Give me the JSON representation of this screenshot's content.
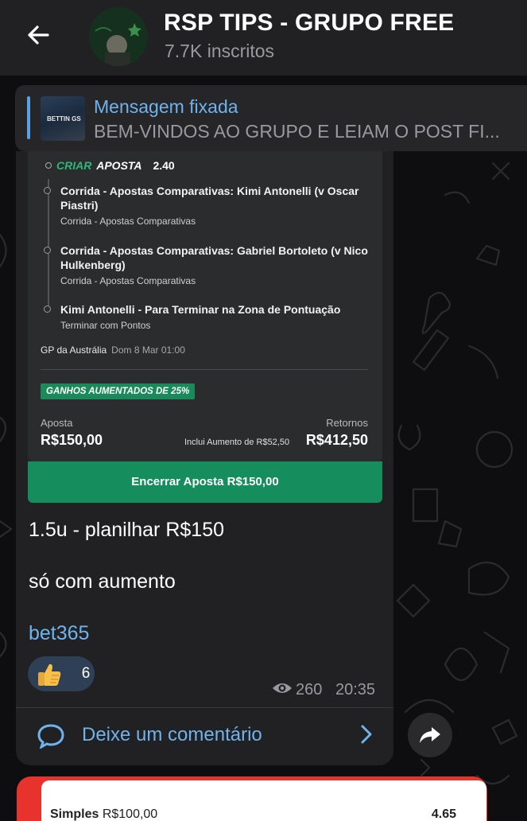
{
  "header": {
    "title": "RSP TIPS - GRUPO FREE",
    "subtitle": "7.7K inscritos"
  },
  "pinned": {
    "title": "Mensagem fixada",
    "text": "BEM-VINDOS AO GRUPO E LEIAM O POST FI...",
    "thumb_text": "BETTIN GS"
  },
  "bet": {
    "criar": "CRIAR",
    "aposta": "APOSTA",
    "odds": "2.40",
    "legs": [
      {
        "title": "Corrida - Apostas Comparativas: Kimi Antonelli (v Oscar Piastri)",
        "sub": "Corrida - Apostas Comparativas"
      },
      {
        "title": "Corrida - Apostas Comparativas: Gabriel Bortoleto (v Nico Hulkenberg)",
        "sub": "Corrida - Apostas Comparativas"
      },
      {
        "title": "Kimi Antonelli - Para Terminar na Zona de Pontuação",
        "sub": "Terminar com Pontos"
      }
    ],
    "event": "GP da Austrália",
    "date": "Dom 8 Mar 01:00",
    "boost": "GANHOS AUMENTADOS DE 25%",
    "stake_label": "Aposta",
    "stake_value": "R$150,00",
    "returns_label": "Retornos",
    "returns_note": "Inclui Aumento de R$52,50",
    "returns_value": "R$412,50",
    "cashout": "Encerrar Aposta  R$150,00"
  },
  "message": {
    "line1": "1.5u - planilhar R$150",
    "line2": "só com aumento",
    "link": "bet365",
    "reaction_count": "6",
    "views": "260",
    "time": "20:35",
    "comment": "Deixe um comentário"
  },
  "next_message": {
    "label_bold": "Simples",
    "label_value": "R$100,00",
    "odds": "4.65"
  },
  "colors": {
    "accent_blue": "#6fb3ee",
    "bet_green": "#168d5c",
    "next_red": "#e8322e"
  }
}
